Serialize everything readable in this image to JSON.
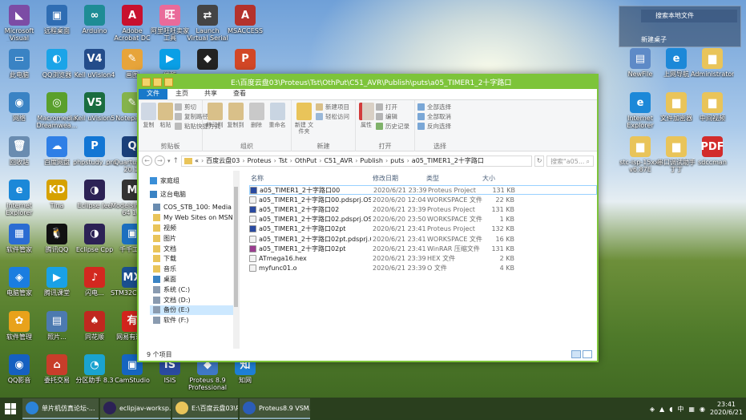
{
  "desktop_left": [
    {
      "label": "Microsoft Visual Studio...",
      "color": "#7c4ca5",
      "glyph": "◣",
      "col": 0,
      "row": 0
    },
    {
      "label": "远程桌面",
      "color": "#2f6db3",
      "glyph": "▣",
      "col": 1,
      "row": 0
    },
    {
      "label": "Arduino",
      "color": "#1e8c95",
      "glyph": "∞",
      "col": 2,
      "row": 0
    },
    {
      "label": "Adobe Acrobat DC",
      "color": "#c8102e",
      "glyph": "A",
      "col": 3,
      "row": 0
    },
    {
      "label": "阿里旺旺卖家工具",
      "color": "#e96b9a",
      "glyph": "旺",
      "col": 4,
      "row": 0
    },
    {
      "label": "Launch Virtual Serial Po...",
      "color": "#444",
      "glyph": "⇄",
      "col": 5,
      "row": 0
    },
    {
      "label": "MSACCESS",
      "color": "#b4322c",
      "glyph": "A",
      "col": 6,
      "row": 0
    },
    {
      "label": "此电脑",
      "color": "#3a83c4",
      "glyph": "▭",
      "col": 0,
      "row": 1
    },
    {
      "label": "QQ浏览器",
      "color": "#1ba4e8",
      "glyph": "◐",
      "col": 1,
      "row": 1
    },
    {
      "label": "Keil uVision4",
      "color": "#234c8a",
      "glyph": "V4",
      "col": 2,
      "row": 1
    },
    {
      "label": "画图",
      "color": "#e7a43a",
      "glyph": "✎",
      "col": 3,
      "row": 1
    },
    {
      "label": "优酷",
      "color": "#0a9fe6",
      "glyph": "▶",
      "col": 4,
      "row": 1
    },
    {
      "label": "",
      "color": "#222",
      "glyph": "◆",
      "col": 5,
      "row": 1
    },
    {
      "label": "",
      "color": "#d24726",
      "glyph": "P",
      "col": 6,
      "row": 1
    },
    {
      "label": "网络",
      "color": "#3a83c4",
      "glyph": "◉",
      "col": 0,
      "row": 2
    },
    {
      "label": "Macromedia Dreamwea...",
      "color": "#5aa02c",
      "glyph": "◎",
      "col": 1,
      "row": 2
    },
    {
      "label": "Keil uVision5",
      "color": "#1a6d3f",
      "glyph": "V5",
      "col": 2,
      "row": 2
    },
    {
      "label": "Notepad...",
      "color": "#85b34b",
      "glyph": "✎",
      "col": 3,
      "row": 2
    },
    {
      "label": "回收站",
      "color": "#6a8cb0",
      "glyph": "🗑",
      "col": 0,
      "row": 3
    },
    {
      "label": "百度网盘",
      "color": "#2f7fe6",
      "glyph": "☁",
      "col": 1,
      "row": 3
    },
    {
      "label": "phpstudy_pro",
      "color": "#1276d4",
      "glyph": "P",
      "col": 2,
      "row": 3
    },
    {
      "label": "Quartus (... 20.1)",
      "color": "#1a3f7a",
      "glyph": "Q",
      "col": 3,
      "row": 3
    },
    {
      "label": "Internet Explorer",
      "color": "#1c88d8",
      "glyph": "e",
      "col": 0,
      "row": 4
    },
    {
      "label": "Tina",
      "color": "#d6a100",
      "glyph": "KD",
      "col": 1,
      "row": 4
    },
    {
      "label": "Eclipse Jee",
      "color": "#2c2255",
      "glyph": "◑",
      "col": 2,
      "row": 4
    },
    {
      "label": "Modelsim SE-64 1...",
      "color": "#333",
      "glyph": "M",
      "col": 3,
      "row": 4
    },
    {
      "label": "软件管家",
      "color": "#2b6cd2",
      "glyph": "▦",
      "col": 0,
      "row": 5
    },
    {
      "label": "腾讯QQ",
      "color": "#111",
      "glyph": "🐧",
      "col": 1,
      "row": 5
    },
    {
      "label": "Eclipse Cpp",
      "color": "#2c2255",
      "glyph": "◑",
      "col": 2,
      "row": 5
    },
    {
      "label": "千千工具",
      "color": "#1c6fbf",
      "glyph": "▣",
      "col": 3,
      "row": 5
    },
    {
      "label": "电脑管家",
      "color": "#1a7de0",
      "glyph": "◈",
      "col": 0,
      "row": 6
    },
    {
      "label": "腾讯课堂",
      "color": "#19a1e6",
      "glyph": "▶",
      "col": 1,
      "row": 6
    },
    {
      "label": "闪电...",
      "color": "#d3281f",
      "glyph": "♪",
      "col": 2,
      "row": 6
    },
    {
      "label": "STM32CubeMX",
      "color": "#1a4f8f",
      "glyph": "MX",
      "col": 3,
      "row": 6
    },
    {
      "label": "软件管理",
      "color": "#e8a21b",
      "glyph": "✿",
      "col": 0,
      "row": 7
    },
    {
      "label": "照片...",
      "color": "#4c7ab0",
      "glyph": "▤",
      "col": 1,
      "row": 7
    },
    {
      "label": "同花顺",
      "color": "#c0281f",
      "glyph": "♠",
      "col": 2,
      "row": 7
    },
    {
      "label": "网易有道...",
      "color": "#d2241c",
      "glyph": "有",
      "col": 3,
      "row": 7
    },
    {
      "label": "QQ影音",
      "color": "#1560c0",
      "glyph": "◉",
      "col": 0,
      "row": 8
    },
    {
      "label": "委托交易",
      "color": "#c83d2a",
      "glyph": "⌂",
      "col": 1,
      "row": 8
    },
    {
      "label": "分区助手 8.3",
      "color": "#1aa3d0",
      "glyph": "◔",
      "col": 2,
      "row": 8
    },
    {
      "label": "CamStudio",
      "color": "#1565c0",
      "glyph": "▣",
      "col": 3,
      "row": 8
    },
    {
      "label": "ISIS",
      "color": "#2a4aa0",
      "glyph": "IS",
      "col": 4,
      "row": 8
    },
    {
      "label": "Proteus 8.9 Professional",
      "color": "#3f78c6",
      "glyph": "◆",
      "col": 5,
      "row": 8
    },
    {
      "label": "知网",
      "color": "#1e7fd6",
      "glyph": "知",
      "col": 6,
      "row": 8
    }
  ],
  "desktop_right": [
    {
      "label": "NewFile",
      "color": "#5e8ac7",
      "glyph": "▤",
      "col": 0,
      "row": 0
    },
    {
      "label": "上网导航",
      "color": "#1c88d8",
      "glyph": "e",
      "col": 1,
      "row": 0
    },
    {
      "label": "Administrator",
      "color": "#e9c45a",
      "glyph": "▆",
      "col": 2,
      "row": 0
    },
    {
      "label": "Internet Explorer",
      "color": "#1c88d8",
      "glyph": "e",
      "col": 0,
      "row": 1
    },
    {
      "label": "文件加密器",
      "color": "#e9c45a",
      "glyph": "▆",
      "col": 1,
      "row": 1
    },
    {
      "label": "中间视频",
      "color": "#e9c45a",
      "glyph": "▆",
      "col": 2,
      "row": 1
    },
    {
      "label": "stc-isp-15xx-v6.87E",
      "color": "#e9c45a",
      "glyph": "▆",
      "col": 0,
      "row": 2
    },
    {
      "label": "串口调试助手丁丁",
      "color": "#e9c45a",
      "glyph": "▆",
      "col": 1,
      "row": 2
    },
    {
      "label": "sdccman",
      "color": "#d22b2b",
      "glyph": "PDF",
      "col": 2,
      "row": 2
    }
  ],
  "right_panel": {
    "search": "搜索本地文件",
    "label": "新建桌子"
  },
  "window": {
    "title": "E:\\百度云盘03\\Proteus\\Tst\\OthPut\\C51_AVR\\Publish\\puts\\a05_TIMER1_2十字路口",
    "tabs": [
      "文件",
      "主页",
      "共享",
      "查看"
    ],
    "ribbon": {
      "clipboard": {
        "label": "剪贴板",
        "copy": "复制",
        "paste": "粘贴",
        "cut": "剪切",
        "copy_path": "复制路径",
        "paste_shortcut": "粘贴快捷方式"
      },
      "organize": {
        "label": "组织",
        "move_to": "移动到",
        "copy_to": "复制到",
        "delete": "删除",
        "rename": "重命名"
      },
      "new": {
        "label": "新建",
        "new_folder": "新建\n文件夹",
        "new_item": "新建项目",
        "easy_access": "轻松访问"
      },
      "open": {
        "label": "打开",
        "properties": "属性",
        "open": "打开",
        "edit": "编辑",
        "history": "历史记录"
      },
      "select": {
        "label": "选择",
        "select_all": "全部选择",
        "select_none": "全部取消",
        "invert": "反向选择"
      }
    },
    "address": {
      "prefix": "«",
      "crumbs": [
        "百度云盘03",
        "Proteus",
        "Tst",
        "OthPut",
        "C51_AVR",
        "Publish",
        "puts",
        "a05_TIMER1_2十字路口"
      ]
    },
    "search_placeholder": "搜索\"a05...",
    "nav": [
      {
        "label": "家庭组",
        "color": "#3a8fd8",
        "indent": 0,
        "gap": true
      },
      {
        "label": "这台电脑",
        "color": "#3a83c4",
        "indent": 0,
        "gap": true
      },
      {
        "label": "COS_STB_100: Media Serv",
        "color": "#6a8cb0",
        "indent": 1
      },
      {
        "label": "My Web Sites on MSN",
        "color": "#e9c45a",
        "indent": 1
      },
      {
        "label": "视频",
        "color": "#e9c45a",
        "indent": 1
      },
      {
        "label": "图片",
        "color": "#e9c45a",
        "indent": 1
      },
      {
        "label": "文档",
        "color": "#e9c45a",
        "indent": 1
      },
      {
        "label": "下载",
        "color": "#e9c45a",
        "indent": 1
      },
      {
        "label": "音乐",
        "color": "#e9c45a",
        "indent": 1
      },
      {
        "label": "桌面",
        "color": "#3a83c4",
        "indent": 1
      },
      {
        "label": "系统 (C:)",
        "color": "#8a9bb0",
        "indent": 1
      },
      {
        "label": "文档 (D:)",
        "color": "#8a9bb0",
        "indent": 1
      },
      {
        "label": "备份 (E:)",
        "color": "#8a9bb0",
        "indent": 1,
        "selected": true
      },
      {
        "label": "软件 (F:)",
        "color": "#8a9bb0",
        "indent": 1
      }
    ],
    "columns": [
      "名称",
      "修改日期",
      "类型",
      "大小"
    ],
    "files": [
      {
        "name": "a05_TIMER1_2十字路口00",
        "date": "2020/6/21 23:39",
        "type": "Proteus Project",
        "size": "131 KB",
        "color": "#2a4aa0",
        "selected": true
      },
      {
        "name": "a05_TIMER1_2十字路口00.pdsprj.OS-...",
        "date": "2020/6/20 12:04",
        "type": "WORKSPACE 文件",
        "size": "22 KB",
        "color": "#f3f3f3"
      },
      {
        "name": "a05_TIMER1_2十字路口02",
        "date": "2020/6/21 23:39",
        "type": "Proteus Project",
        "size": "131 KB",
        "color": "#2a4aa0"
      },
      {
        "name": "a05_TIMER1_2十字路口02.pdsprj.OS-...",
        "date": "2020/6/20 23:50",
        "type": "WORKSPACE 文件",
        "size": "1 KB",
        "color": "#f3f3f3"
      },
      {
        "name": "a05_TIMER1_2十字路口02pt",
        "date": "2020/6/21 23:41",
        "type": "Proteus Project",
        "size": "132 KB",
        "color": "#2a4aa0"
      },
      {
        "name": "a05_TIMER1_2十字路口02pt.pdsprj.O...",
        "date": "2020/6/21 23:41",
        "type": "WORKSPACE 文件",
        "size": "16 KB",
        "color": "#f3f3f3"
      },
      {
        "name": "a05_TIMER1_2十字路口02pt",
        "date": "2020/6/21 23:41",
        "type": "WinRAR 压缩文件",
        "size": "131 KB",
        "color": "#9a3d8f"
      },
      {
        "name": "ATmega16.hex",
        "date": "2020/6/21 23:39",
        "type": "HEX 文件",
        "size": "2 KB",
        "color": "#f3f3f3"
      },
      {
        "name": "myfunc01.o",
        "date": "2020/6/21 23:39",
        "type": "O 文件",
        "size": "4 KB",
        "color": "#f3f3f3"
      }
    ],
    "status": "9 个项目"
  },
  "taskbar": {
    "items": [
      {
        "label": "单片机仿真论坛-...",
        "color": "#2b83d8"
      },
      {
        "label": "eclipjav-worksp...",
        "color": "#2c2255"
      },
      {
        "label": "E:\\百度云盘03\\Pr...",
        "color": "#e9c45a"
      },
      {
        "label": "Proteus8.9 VSM...",
        "color": "#2b5db8"
      }
    ],
    "ime": "中",
    "time": "23:41",
    "date": "2020/6/21"
  }
}
